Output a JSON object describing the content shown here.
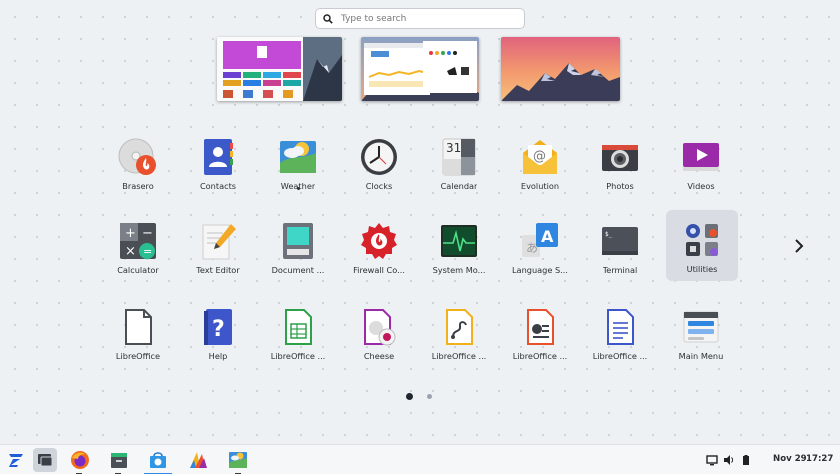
{
  "search": {
    "placeholder": "Type to search",
    "icon": "search-icon"
  },
  "apps_row1": [
    {
      "label": "Brasero",
      "icon": "brasero-disc-icon"
    },
    {
      "label": "Contacts",
      "icon": "contacts-icon"
    },
    {
      "label": "Weather",
      "icon": "weather-icon",
      "running": true
    },
    {
      "label": "Clocks",
      "icon": "clock-icon"
    },
    {
      "label": "Calendar",
      "icon": "calendar-icon",
      "day": "31"
    },
    {
      "label": "Evolution",
      "icon": "mail-icon"
    },
    {
      "label": "Photos",
      "icon": "camera-icon"
    },
    {
      "label": "Videos",
      "icon": "video-player-icon"
    }
  ],
  "apps_row2": [
    {
      "label": "Calculator",
      "icon": "calculator-icon"
    },
    {
      "label": "Text Editor",
      "icon": "text-editor-icon"
    },
    {
      "label": "Document ...",
      "icon": "document-scanner-icon"
    },
    {
      "label": "Firewall Co...",
      "icon": "firewall-icon"
    },
    {
      "label": "System Mo...",
      "icon": "system-monitor-icon"
    },
    {
      "label": "Language S...",
      "icon": "language-support-icon"
    },
    {
      "label": "Terminal",
      "icon": "terminal-icon"
    },
    {
      "label": "Utilities",
      "icon": "utilities-folder-icon",
      "selected": true
    }
  ],
  "apps_row3": [
    {
      "label": "LibreOffice",
      "icon": "libreoffice-icon"
    },
    {
      "label": "Help",
      "icon": "help-icon"
    },
    {
      "label": "LibreOffice ...",
      "icon": "libreoffice-calc-icon"
    },
    {
      "label": "Cheese",
      "icon": "cheese-webcam-icon"
    },
    {
      "label": "LibreOffice ...",
      "icon": "libreoffice-draw-icon"
    },
    {
      "label": "LibreOffice ...",
      "icon": "libreoffice-impress-icon"
    },
    {
      "label": "LibreOffice ...",
      "icon": "libreoffice-writer-icon"
    },
    {
      "label": "Main Menu",
      "icon": "main-menu-icon"
    }
  ],
  "pager": {
    "pages": 2,
    "current": 1
  },
  "taskbar": {
    "items": [
      "zorin-menu-icon",
      "workspaces-icon",
      "firefox-icon",
      "files-icon",
      "software-store-icon",
      "appearance-icon",
      "weather-icon"
    ],
    "tray": [
      "screen-icon",
      "volume-icon",
      "battery-icon"
    ],
    "date": "Nov 29",
    "time": "17:27"
  },
  "colors": {
    "background": "#eef1f4",
    "accent": "#15a6f0",
    "selected_tile": "#d9dde3"
  }
}
